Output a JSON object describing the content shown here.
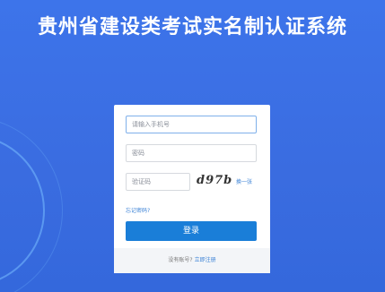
{
  "header": {
    "title": "贵州省建设类考试实名制认证系统"
  },
  "login": {
    "phone_placeholder": "请输入手机号",
    "password_placeholder": "密码",
    "captcha_placeholder": "验证码",
    "captcha_text": "d97b",
    "refresh_label": "换一张",
    "forgot_label": "忘记密码?",
    "submit_label": "登录",
    "no_account_text": "没有账号?",
    "register_label": "立即注册"
  },
  "colors": {
    "background": "#3b6fe0",
    "primary_button": "#1a7ed8",
    "link": "#3b82d6"
  }
}
